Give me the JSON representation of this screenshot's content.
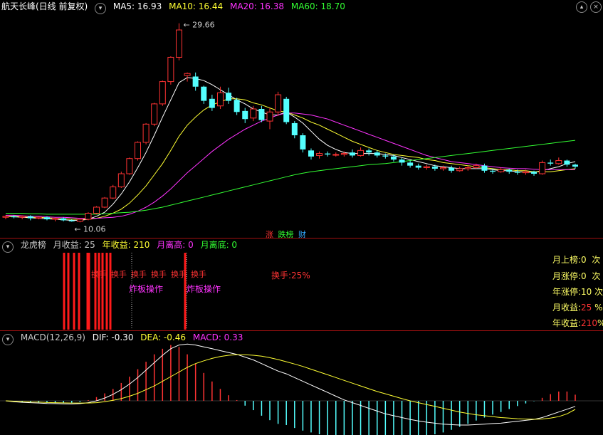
{
  "header": {
    "stock_name": "航天长峰(日线 前复权)",
    "ma": [
      {
        "label": "MA5: 16.93",
        "color": "#ffffff"
      },
      {
        "label": "MA10: 16.44",
        "color": "#ffff33"
      },
      {
        "label": "MA20: 16.38",
        "color": "#ff33ff"
      },
      {
        "label": "MA60: 18.70",
        "color": "#33ff33"
      }
    ]
  },
  "tags": {
    "zhang": "涨",
    "diebang": "跌榜",
    "cai": "财"
  },
  "lhb_panel": {
    "title": "龙虎榜",
    "items": [
      "月收益: 25",
      "年收益: 210",
      "月离高: 0",
      "月离底: 0"
    ],
    "annotations": [
      "换手:25%",
      "炸板操作",
      "炸板操作"
    ],
    "side": [
      {
        "label": "月上榜:0",
        "unit": "次"
      },
      {
        "label": "月涨停:0",
        "unit": "次"
      },
      {
        "label": "年涨停:10",
        "unit": "次"
      },
      {
        "label": "月收益:",
        "value": "25",
        "unit": "%"
      },
      {
        "label": "年收益:",
        "value": "210",
        "unit": "%"
      }
    ]
  },
  "macd_panel": {
    "title": "MACD(12,26,9)",
    "dif": "DIF: -0.30",
    "dea": "DEA: -0.46",
    "macd": "MACD: 0.33"
  },
  "chart_data": {
    "type": "candlestick",
    "price_range": [
      10.06,
      29.66
    ],
    "max_label": "29.66",
    "min_label": "10.06",
    "candles": [
      [
        10.5,
        10.6,
        10.3,
        10.7
      ],
      [
        10.6,
        10.5,
        10.4,
        10.7
      ],
      [
        10.5,
        10.6,
        10.3,
        10.7
      ],
      [
        10.6,
        10.4,
        10.2,
        10.7
      ],
      [
        10.4,
        10.5,
        10.3,
        10.6
      ],
      [
        10.5,
        10.3,
        10.2,
        10.6
      ],
      [
        10.3,
        10.4,
        10.1,
        10.5
      ],
      [
        10.4,
        10.2,
        10.1,
        10.5
      ],
      [
        10.2,
        10.1,
        10.06,
        10.3
      ],
      [
        10.1,
        10.3,
        10.0,
        10.4
      ],
      [
        10.3,
        10.9,
        10.2,
        11.0
      ],
      [
        10.9,
        11.5,
        10.8,
        11.6
      ],
      [
        11.5,
        12.4,
        11.4,
        12.5
      ],
      [
        12.4,
        13.5,
        12.3,
        13.7
      ],
      [
        13.5,
        14.8,
        13.4,
        15.0
      ],
      [
        14.8,
        16.3,
        14.7,
        16.4
      ],
      [
        16.3,
        17.9,
        16.1,
        18.0
      ],
      [
        17.9,
        19.7,
        17.7,
        19.8
      ],
      [
        19.7,
        21.7,
        19.5,
        21.8
      ],
      [
        21.7,
        23.9,
        21.5,
        24.0
      ],
      [
        23.9,
        26.3,
        23.6,
        26.4
      ],
      [
        26.3,
        29.0,
        26.0,
        29.66
      ],
      [
        24.5,
        24.7,
        23.9,
        24.8
      ],
      [
        24.4,
        23.4,
        23.0,
        24.8
      ],
      [
        23.4,
        22.0,
        21.7,
        23.5
      ],
      [
        22.2,
        21.3,
        21.0,
        22.6
      ],
      [
        21.5,
        22.8,
        21.2,
        23.4
      ],
      [
        22.8,
        22.0,
        21.7,
        23.3
      ],
      [
        22.1,
        20.9,
        20.6,
        22.3
      ],
      [
        21.0,
        20.2,
        19.8,
        21.3
      ],
      [
        20.3,
        21.2,
        20.0,
        21.5
      ],
      [
        21.2,
        20.1,
        19.9,
        21.5
      ],
      [
        20.0,
        20.9,
        19.2,
        21.3
      ],
      [
        20.9,
        22.6,
        20.5,
        22.9
      ],
      [
        22.2,
        19.9,
        19.7,
        22.4
      ],
      [
        19.8,
        18.6,
        18.3,
        20.0
      ],
      [
        18.6,
        17.2,
        16.9,
        18.8
      ],
      [
        17.1,
        16.5,
        16.2,
        17.3
      ],
      [
        16.6,
        16.8,
        16.3,
        17.0
      ],
      [
        16.8,
        16.7,
        16.5,
        17.0
      ],
      [
        16.7,
        16.7,
        16.5,
        16.9
      ],
      [
        16.7,
        16.8,
        16.5,
        17.0
      ],
      [
        16.9,
        16.6,
        16.4,
        17.2
      ],
      [
        16.6,
        17.1,
        16.5,
        17.4
      ],
      [
        17.1,
        16.9,
        16.6,
        17.3
      ],
      [
        16.9,
        16.6,
        16.4,
        17.1
      ],
      [
        16.6,
        16.5,
        16.3,
        16.8
      ],
      [
        16.5,
        16.2,
        16.0,
        16.7
      ],
      [
        16.2,
        15.9,
        15.6,
        16.4
      ],
      [
        15.9,
        15.6,
        15.4,
        16.1
      ],
      [
        15.6,
        15.4,
        15.2,
        15.8
      ],
      [
        15.4,
        15.5,
        15.2,
        15.7
      ],
      [
        15.5,
        15.3,
        15.1,
        15.7
      ],
      [
        15.3,
        15.4,
        15.1,
        15.6
      ],
      [
        15.4,
        15.1,
        14.9,
        15.6
      ],
      [
        15.1,
        15.3,
        15.0,
        15.5
      ],
      [
        15.3,
        15.4,
        15.1,
        15.6
      ],
      [
        15.4,
        15.6,
        15.3,
        15.8
      ],
      [
        15.6,
        15.1,
        14.9,
        15.8
      ],
      [
        15.1,
        15.0,
        14.8,
        15.3
      ],
      [
        15.0,
        15.2,
        14.9,
        15.4
      ],
      [
        15.2,
        15.0,
        14.8,
        15.3
      ],
      [
        15.0,
        14.9,
        14.7,
        15.2
      ],
      [
        14.9,
        15.0,
        14.7,
        15.2
      ],
      [
        15.0,
        14.8,
        14.6,
        15.1
      ],
      [
        14.8,
        15.9,
        14.7,
        16.1
      ],
      [
        15.9,
        15.8,
        15.6,
        16.2
      ],
      [
        15.8,
        16.1,
        15.7,
        16.4
      ],
      [
        16.1,
        15.7,
        15.5,
        16.2
      ],
      [
        15.7,
        15.5,
        15.3,
        15.8
      ]
    ],
    "ma": {
      "MA5": [
        10.6,
        10.55,
        10.5,
        10.45,
        10.4,
        10.35,
        10.3,
        10.25,
        10.2,
        10.2,
        10.3,
        10.6,
        11.0,
        11.8,
        12.8,
        14.0,
        15.4,
        16.9,
        18.6,
        20.4,
        22.1,
        23.8,
        24.3,
        24.2,
        24.0,
        23.6,
        23.1,
        22.6,
        22.1,
        21.7,
        21.2,
        20.9,
        20.6,
        20.6,
        20.9,
        20.4,
        19.8,
        19.0,
        18.2,
        17.6,
        17.2,
        16.9,
        16.8,
        16.8,
        16.8,
        16.8,
        16.7,
        16.6,
        16.4,
        16.2,
        16.0,
        15.8,
        15.6,
        15.5,
        15.4,
        15.3,
        15.3,
        15.3,
        15.3,
        15.2,
        15.1,
        15.1,
        15.0,
        14.95,
        14.95,
        15.1,
        15.3,
        15.5,
        15.8,
        16.0
      ],
      "MA10": [
        10.6,
        10.6,
        10.55,
        10.5,
        10.5,
        10.45,
        10.4,
        10.35,
        10.3,
        10.3,
        10.3,
        10.4,
        10.6,
        10.9,
        11.3,
        11.9,
        12.7,
        13.6,
        14.7,
        15.8,
        17.1,
        18.5,
        19.6,
        20.4,
        21.1,
        21.6,
        21.9,
        22.2,
        22.2,
        22.1,
        21.8,
        21.6,
        21.3,
        21.0,
        20.9,
        20.6,
        20.3,
        19.9,
        19.6,
        19.2,
        18.8,
        18.4,
        18.0,
        17.7,
        17.4,
        17.1,
        16.9,
        16.7,
        16.6,
        16.5,
        16.4,
        16.2,
        16.1,
        15.9,
        15.8,
        15.7,
        15.6,
        15.5,
        15.4,
        15.3,
        15.2,
        15.2,
        15.1,
        15.1,
        15.0,
        15.0,
        15.0,
        15.1,
        15.2,
        15.3
      ],
      "MA20": [
        10.7,
        10.7,
        10.65,
        10.6,
        10.6,
        10.55,
        10.5,
        10.5,
        10.45,
        10.4,
        10.4,
        10.4,
        10.45,
        10.5,
        10.6,
        10.8,
        11.1,
        11.5,
        12.0,
        12.6,
        13.3,
        14.1,
        14.9,
        15.6,
        16.3,
        17.0,
        17.6,
        18.2,
        18.7,
        19.2,
        19.6,
        20.0,
        20.3,
        20.6,
        20.8,
        20.8,
        20.7,
        20.6,
        20.4,
        20.2,
        19.9,
        19.6,
        19.3,
        19.0,
        18.7,
        18.4,
        18.1,
        17.8,
        17.5,
        17.2,
        16.9,
        16.6,
        16.4,
        16.2,
        16.0,
        15.9,
        15.8,
        15.7,
        15.6,
        15.5,
        15.4,
        15.35,
        15.3,
        15.3,
        15.25,
        15.2,
        15.2,
        15.2,
        15.2,
        15.2
      ],
      "MA60": [
        10.9,
        10.9,
        10.9,
        10.85,
        10.85,
        10.8,
        10.8,
        10.8,
        10.8,
        10.8,
        10.8,
        10.8,
        10.85,
        10.9,
        10.95,
        11.0,
        11.1,
        11.2,
        11.35,
        11.5,
        11.7,
        11.9,
        12.1,
        12.3,
        12.5,
        12.7,
        12.9,
        13.1,
        13.3,
        13.5,
        13.7,
        13.9,
        14.1,
        14.3,
        14.5,
        14.7,
        14.85,
        15.0,
        15.1,
        15.2,
        15.3,
        15.4,
        15.5,
        15.6,
        15.7,
        15.75,
        15.8,
        15.9,
        16.0,
        16.1,
        16.2,
        16.3,
        16.4,
        16.5,
        16.6,
        16.7,
        16.8,
        16.9,
        17.0,
        17.1,
        17.2,
        17.3,
        17.4,
        17.5,
        17.6,
        17.7,
        17.8,
        17.9,
        18.0,
        18.1
      ]
    },
    "macd": {
      "range": [
        -3.0,
        3.0
      ],
      "dif": [
        0.0,
        -0.05,
        -0.08,
        -0.1,
        -0.12,
        -0.14,
        -0.15,
        -0.16,
        -0.17,
        -0.15,
        -0.1,
        0.0,
        0.15,
        0.35,
        0.6,
        0.9,
        1.25,
        1.65,
        2.05,
        2.45,
        2.8,
        3.0,
        3.05,
        3.0,
        2.9,
        2.8,
        2.7,
        2.6,
        2.5,
        2.35,
        2.2,
        2.0,
        1.8,
        1.6,
        1.45,
        1.25,
        1.05,
        0.85,
        0.65,
        0.45,
        0.25,
        0.05,
        -0.1,
        -0.25,
        -0.4,
        -0.55,
        -0.7,
        -0.8,
        -0.9,
        -1.0,
        -1.08,
        -1.15,
        -1.2,
        -1.25,
        -1.28,
        -1.3,
        -1.3,
        -1.28,
        -1.25,
        -1.22,
        -1.2,
        -1.15,
        -1.1,
        -1.05,
        -1.0,
        -0.9,
        -0.75,
        -0.6,
        -0.45,
        -0.3
      ],
      "dea": [
        0.0,
        -0.02,
        -0.04,
        -0.06,
        -0.07,
        -0.09,
        -0.1,
        -0.11,
        -0.12,
        -0.12,
        -0.12,
        -0.1,
        -0.05,
        0.03,
        0.12,
        0.25,
        0.4,
        0.6,
        0.8,
        1.05,
        1.3,
        1.55,
        1.8,
        2.0,
        2.15,
        2.28,
        2.38,
        2.45,
        2.48,
        2.48,
        2.45,
        2.4,
        2.32,
        2.22,
        2.1,
        1.98,
        1.85,
        1.7,
        1.55,
        1.4,
        1.25,
        1.1,
        0.95,
        0.8,
        0.65,
        0.5,
        0.38,
        0.25,
        0.12,
        0.0,
        -0.1,
        -0.2,
        -0.3,
        -0.4,
        -0.5,
        -0.6,
        -0.68,
        -0.75,
        -0.8,
        -0.85,
        -0.9,
        -0.93,
        -0.96,
        -0.98,
        -0.99,
        -0.98,
        -0.93,
        -0.85,
        -0.7,
        -0.46
      ],
      "macd": [
        0.0,
        -0.06,
        -0.08,
        -0.08,
        -0.1,
        -0.1,
        -0.1,
        -0.1,
        -0.1,
        -0.06,
        0.04,
        0.2,
        0.4,
        0.64,
        0.96,
        1.3,
        1.7,
        2.1,
        2.5,
        2.8,
        3.0,
        2.9,
        2.5,
        2.0,
        1.5,
        1.04,
        0.64,
        0.3,
        0.04,
        -0.26,
        -0.5,
        -0.8,
        -1.04,
        -1.24,
        -1.3,
        -1.46,
        -1.6,
        -1.7,
        -1.8,
        -1.9,
        -2.0,
        -2.1,
        -2.1,
        -2.1,
        -2.1,
        -2.1,
        -2.16,
        -2.1,
        -2.04,
        -2.0,
        -1.96,
        -1.9,
        -1.8,
        -1.7,
        -1.56,
        -1.4,
        -1.24,
        -1.06,
        -0.9,
        -0.74,
        -0.6,
        -0.44,
        -0.28,
        -0.14,
        -0.02,
        0.16,
        0.36,
        0.5,
        0.5,
        0.33
      ]
    }
  },
  "lhb_bars": [
    0.82,
    0.88,
    0.96,
    1.03,
    1.15,
    1.17,
    1.26,
    1.31,
    1.36,
    1.42,
    1.47,
    2.52
  ]
}
